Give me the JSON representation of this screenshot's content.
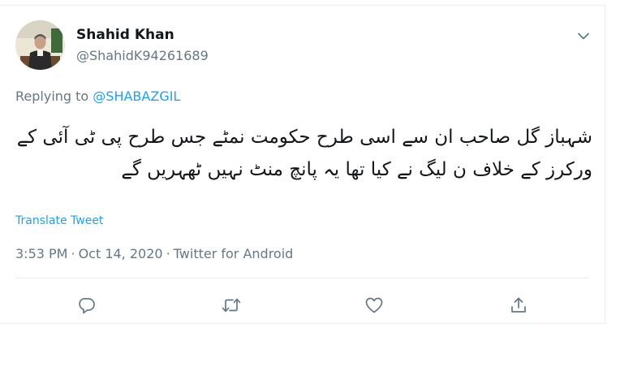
{
  "tweet": {
    "author": {
      "display_name": "Shahid Khan",
      "handle": "@ShahidK94261689",
      "avatar_icon": "profile-photo"
    },
    "reply_prefix": "Replying to ",
    "reply_to": "@SHABAZGIL",
    "text": "شہباز گل صاحب ان سے اسی طرح حکومت نمٹے جس طرح پی ٹی آئی کے ورکرز کے خلاف ن لیگ نے کیا تھا یہ پانچ منٹ نہیں ٹھہریں گے",
    "translate_label": "Translate Tweet",
    "time": "3:53 PM",
    "separator": "·",
    "date": "Oct 14, 2020",
    "source": "Twitter for Android",
    "actions": [
      {
        "name": "reply",
        "icon": "speech-bubble-icon"
      },
      {
        "name": "retweet",
        "icon": "retweet-arrows-icon"
      },
      {
        "name": "like",
        "icon": "heart-icon"
      },
      {
        "name": "share",
        "icon": "share-upload-icon"
      }
    ],
    "menu_icon": "chevron-down-icon"
  },
  "colors": {
    "accent": "#1da1f2",
    "secondary_text": "#657786",
    "primary_text": "#14171a",
    "border": "#e6ecf0"
  }
}
